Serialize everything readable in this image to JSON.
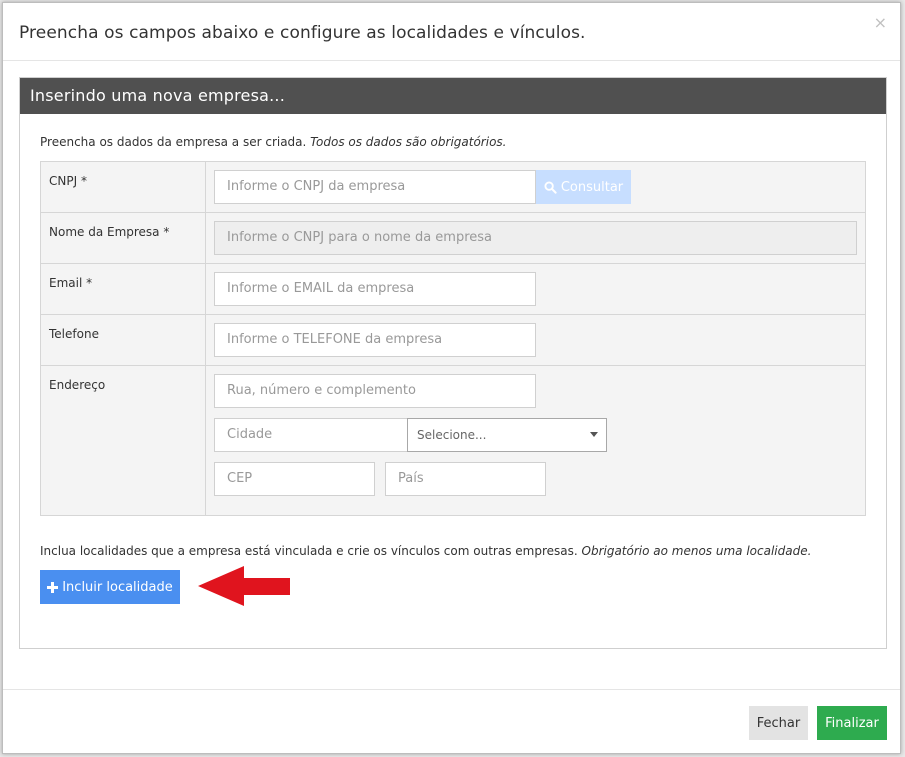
{
  "modal": {
    "title": "Preencha os campos abaixo e configure as localidades e vínculos.",
    "close_glyph": "×"
  },
  "panel": {
    "heading": "Inserindo uma nova empresa...",
    "intro_text": "Preencha os dados da empresa a ser criada. ",
    "intro_italic": "Todos os dados são obrigatórios."
  },
  "form": {
    "cnpj": {
      "label": "CNPJ *",
      "placeholder": "Informe o CNPJ da empresa",
      "button_label": "Consultar"
    },
    "nome": {
      "label": "Nome da Empresa *",
      "placeholder": "Informe o CNPJ para o nome da empresa"
    },
    "email": {
      "label": "Email *",
      "placeholder": "Informe o EMAIL da empresa"
    },
    "telefone": {
      "label": "Telefone",
      "placeholder": "Informe o TELEFONE da empresa"
    },
    "endereco": {
      "label": "Endereço",
      "rua_placeholder": "Rua, número e complemento",
      "cidade_placeholder": "Cidade",
      "estado_selected": "Selecione...",
      "cep_placeholder": "CEP",
      "pais_placeholder": "País"
    }
  },
  "localidades": {
    "text": "Inclua localidades que a empresa está vinculada e crie os vínculos com outras empresas. ",
    "italic": "Obrigatório ao menos uma localidade.",
    "button_label": "Incluir localidade"
  },
  "footer": {
    "fechar_label": "Fechar",
    "finalizar_label": "Finalizar"
  },
  "colors": {
    "panel_heading_bg": "#505050",
    "primary_blue": "#4a8ff0",
    "consultar_disabled": "#c7deff",
    "success_green": "#2eab4f",
    "annotation_red": "#e0141e"
  },
  "icons": {
    "consultar": "search-icon",
    "incluir": "plus-icon",
    "annotation": "red-arrow-left"
  }
}
